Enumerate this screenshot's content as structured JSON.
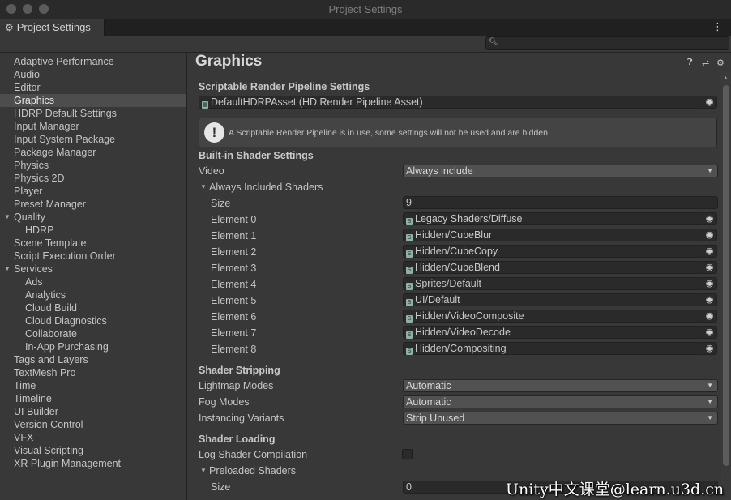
{
  "window": {
    "title": "Project Settings"
  },
  "tab": {
    "label": "Project Settings",
    "icon": "gear-icon"
  },
  "search": {
    "placeholder": "",
    "icon": "search-icon"
  },
  "sidebar": {
    "items": [
      "Adaptive Performance",
      "Audio",
      "Editor",
      "Graphics",
      "HDRP Default Settings",
      "Input Manager",
      "Input System Package",
      "Package Manager",
      "Physics",
      "Physics 2D",
      "Player",
      "Preset Manager",
      "Quality",
      "HDRP",
      "Scene Template",
      "Script Execution Order",
      "Services",
      "Ads",
      "Analytics",
      "Cloud Build",
      "Cloud Diagnostics",
      "Collaborate",
      "In-App Purchasing",
      "Tags and Layers",
      "TextMesh Pro",
      "Time",
      "Timeline",
      "UI Builder",
      "Version Control",
      "VFX",
      "Visual Scripting",
      "XR Plugin Management"
    ],
    "selected": "Graphics"
  },
  "header": {
    "title": "Graphics"
  },
  "srp": {
    "section": "Scriptable Render Pipeline Settings",
    "asset": "DefaultHDRPAsset (HD Render Pipeline Asset)",
    "help": "A Scriptable Render Pipeline is in use, some settings will not be used and are hidden"
  },
  "builtin": {
    "section": "Built-in Shader Settings",
    "video_label": "Video",
    "video_value": "Always include",
    "always_included_label": "Always Included Shaders",
    "size_label": "Size",
    "size_value": "9",
    "elements": [
      {
        "label": "Element 0",
        "value": "Legacy Shaders/Diffuse"
      },
      {
        "label": "Element 1",
        "value": "Hidden/CubeBlur"
      },
      {
        "label": "Element 2",
        "value": "Hidden/CubeCopy"
      },
      {
        "label": "Element 3",
        "value": "Hidden/CubeBlend"
      },
      {
        "label": "Element 4",
        "value": "Sprites/Default"
      },
      {
        "label": "Element 5",
        "value": "UI/Default"
      },
      {
        "label": "Element 6",
        "value": "Hidden/VideoComposite"
      },
      {
        "label": "Element 7",
        "value": "Hidden/VideoDecode"
      },
      {
        "label": "Element 8",
        "value": "Hidden/Compositing"
      }
    ]
  },
  "stripping": {
    "section": "Shader Stripping",
    "lightmap_label": "Lightmap Modes",
    "lightmap_value": "Automatic",
    "fog_label": "Fog Modes",
    "fog_value": "Automatic",
    "instancing_label": "Instancing Variants",
    "instancing_value": "Strip Unused"
  },
  "loading": {
    "section": "Shader Loading",
    "log_label": "Log Shader Compilation",
    "log_checked": false,
    "preloaded_label": "Preloaded Shaders",
    "size_label": "Size",
    "size_value": "0"
  },
  "watermark": "Unity中文课堂@learn.u3d.cn"
}
